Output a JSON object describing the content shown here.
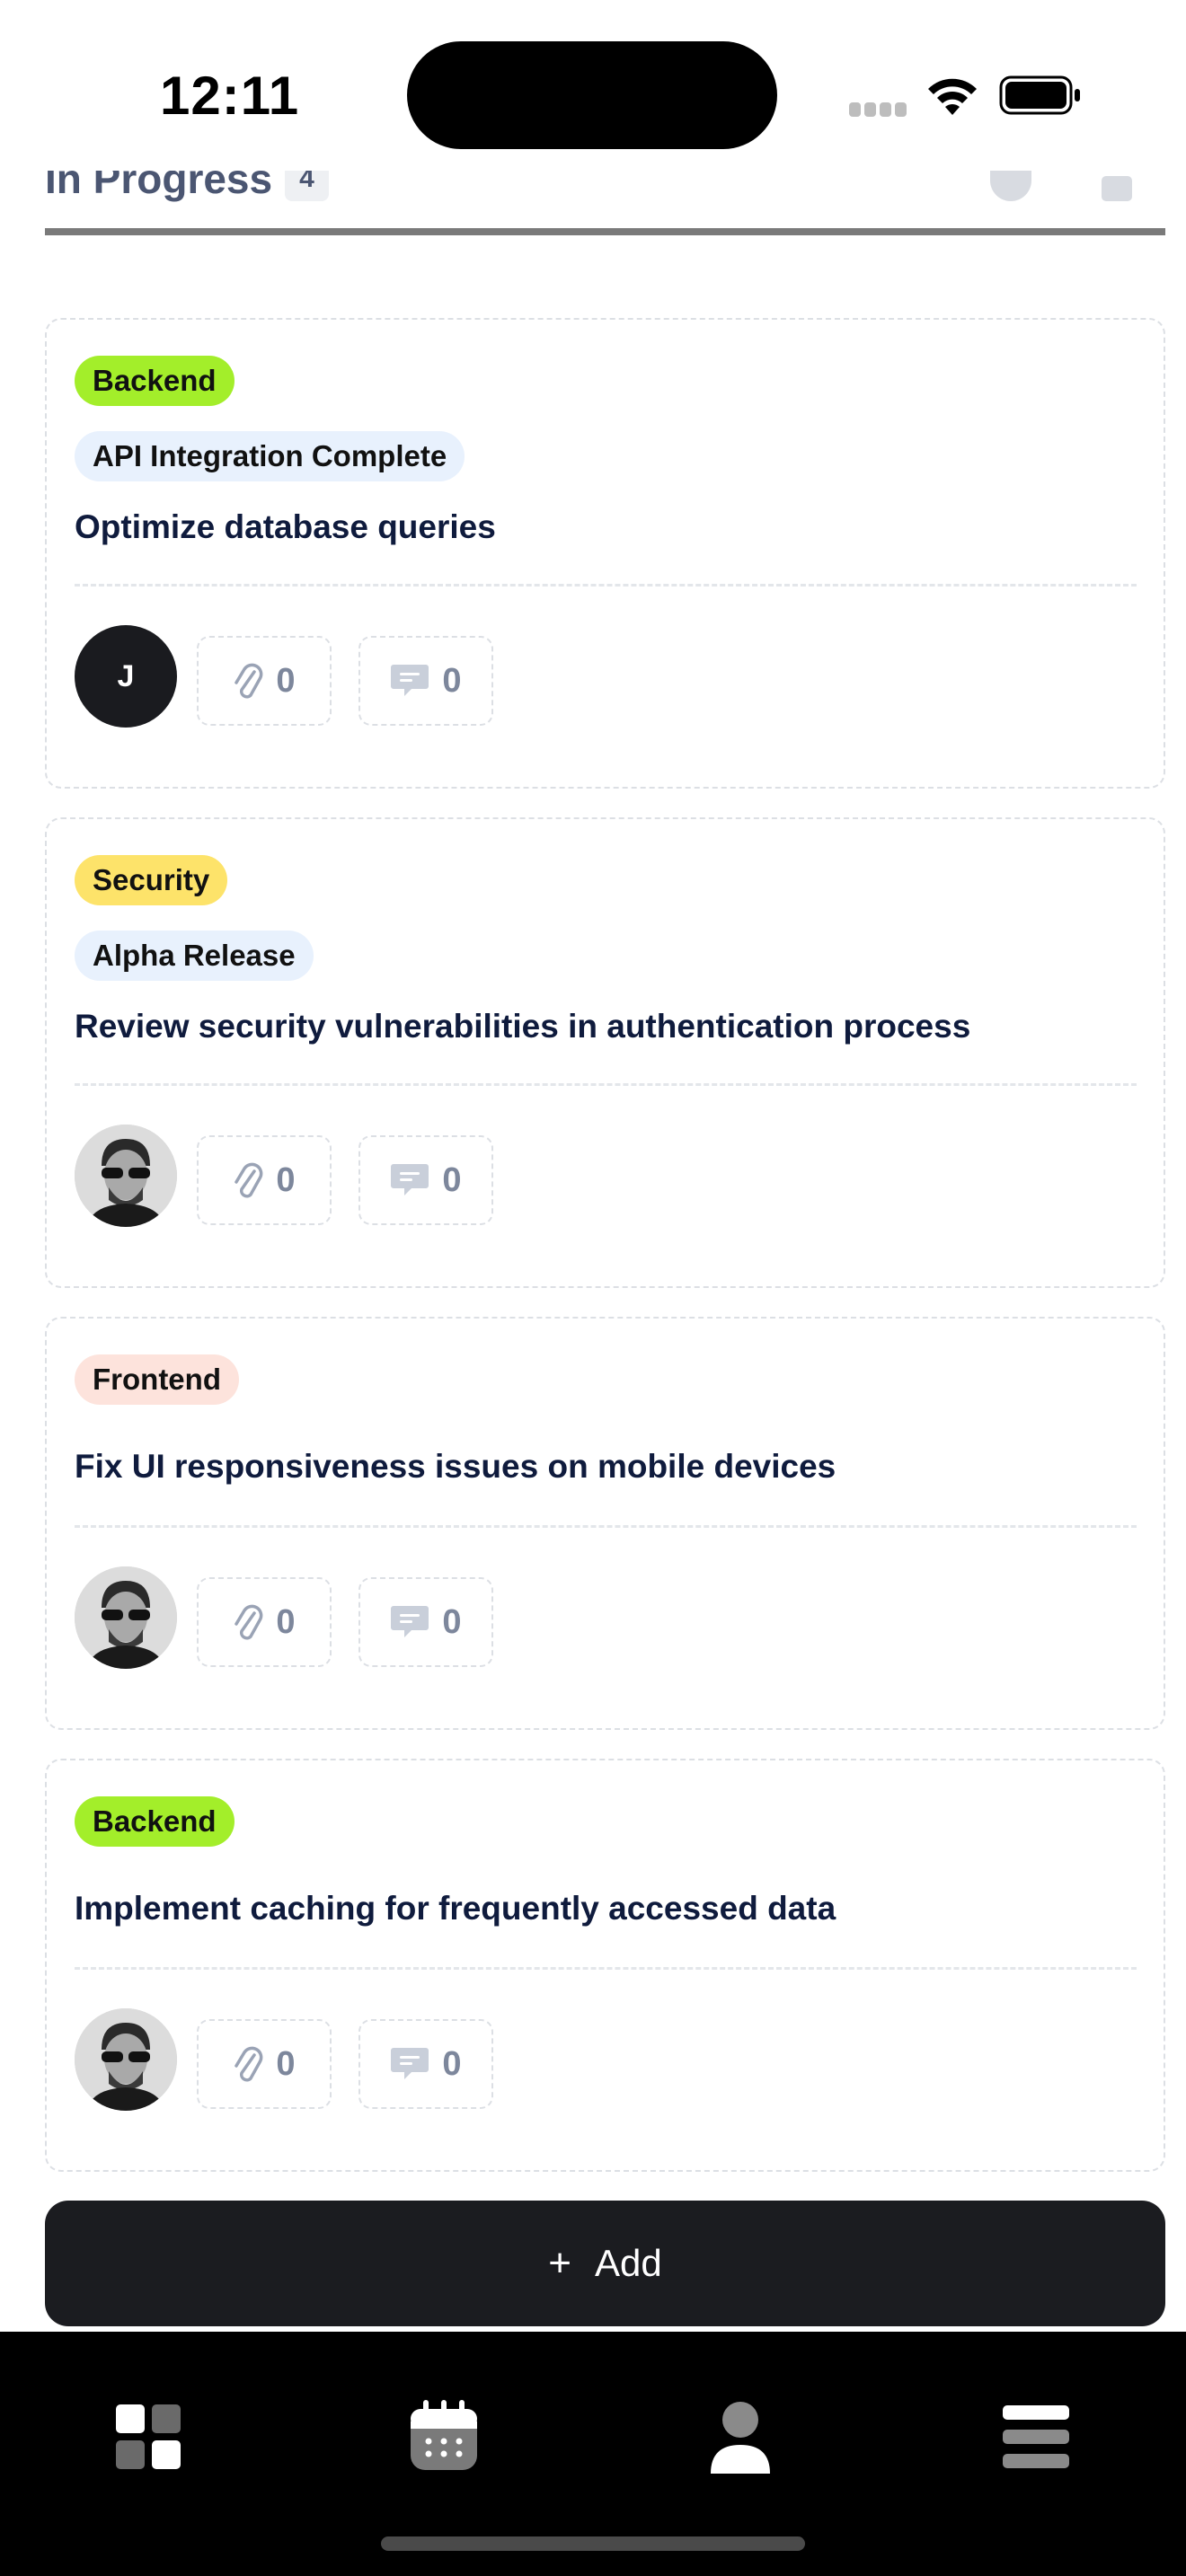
{
  "status_bar": {
    "time": "12:11"
  },
  "column": {
    "title": "In Progress",
    "count": "4"
  },
  "cards": [
    {
      "tag": "Backend",
      "tag_color": "#a3ee2a",
      "milestone": "API Integration Complete",
      "title": "Optimize database queries",
      "assignee_initial": "J",
      "attachments": "0",
      "comments": "0"
    },
    {
      "tag": "Security",
      "tag_color": "#fde36a",
      "milestone": "Alpha Release",
      "title": "Review security vulnerabilities in authentication process",
      "assignee_initial": "",
      "attachments": "0",
      "comments": "0"
    },
    {
      "tag": "Frontend",
      "tag_color": "#fde3dc",
      "milestone": "",
      "title": "Fix UI responsiveness issues on mobile devices",
      "assignee_initial": "",
      "attachments": "0",
      "comments": "0"
    },
    {
      "tag": "Backend",
      "tag_color": "#a3ee2a",
      "milestone": "",
      "title": "Implement caching for frequently accessed data",
      "assignee_initial": "",
      "attachments": "0",
      "comments": "0"
    }
  ],
  "add_button": {
    "plus": "+",
    "label": "Add"
  },
  "bottom_nav": {
    "items": [
      {
        "icon": "dashboard-grid-icon"
      },
      {
        "icon": "calendar-icon"
      },
      {
        "icon": "profile-icon"
      },
      {
        "icon": "menu-icon"
      }
    ]
  },
  "colors": {
    "accent_dark": "#1b1c20",
    "muted_text": "#7d879c"
  }
}
